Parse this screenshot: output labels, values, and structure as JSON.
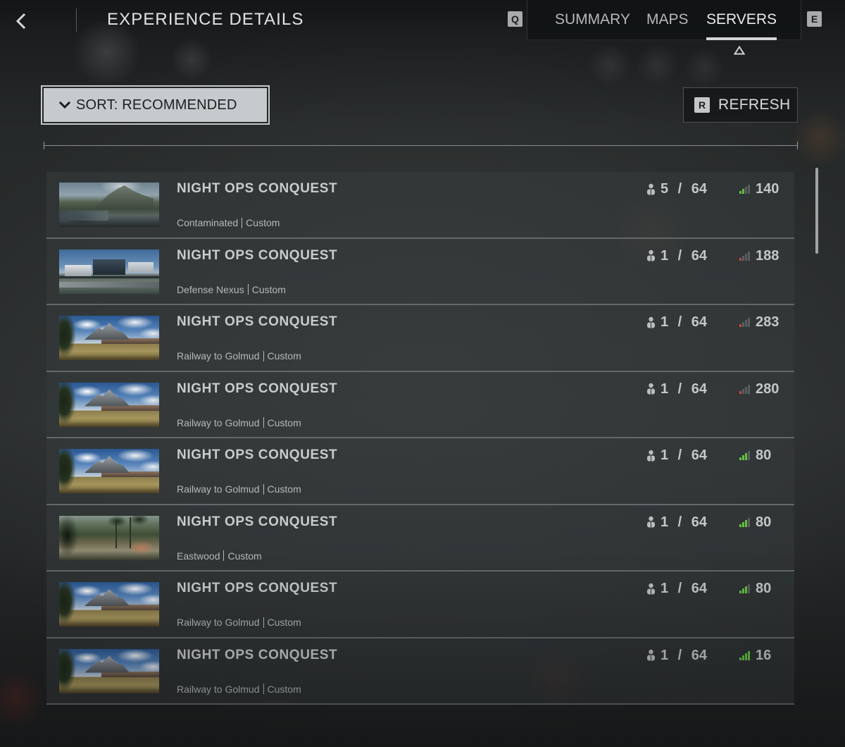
{
  "header": {
    "title": "EXPERIENCE DETAILS",
    "key_prev": "Q",
    "key_next": "E",
    "tabs": [
      {
        "label": "SUMMARY",
        "active": false
      },
      {
        "label": "MAPS",
        "active": false
      },
      {
        "label": "SERVERS",
        "active": true
      }
    ]
  },
  "toolbar": {
    "sort_label": "SORT: RECOMMENDED",
    "refresh_key": "R",
    "refresh_label": "REFRESH"
  },
  "icons": {
    "back": "chevron-left-icon",
    "sort": "chevron-down-icon",
    "tab_indicator": "triangle-up-icon",
    "players": "players-icon",
    "ping": "signal-bars-icon"
  },
  "colors": {
    "signal_good": "#63c03f",
    "signal_poor": "#c9483b",
    "signal_off": "#595d5f",
    "active_tab_underline": "#d3d6d8"
  },
  "servers": [
    {
      "name": "NIGHT OPS CONQUEST",
      "map": "Contaminated",
      "mode": "Custom",
      "players": "5 / 64",
      "ping": "140",
      "signal": {
        "level": 2,
        "color": "#63c03f"
      }
    },
    {
      "name": "NIGHT OPS CONQUEST",
      "map": "Defense Nexus",
      "mode": "Custom",
      "players": "1 / 64",
      "ping": "188",
      "signal": {
        "level": 1,
        "color": "#c9483b"
      }
    },
    {
      "name": "NIGHT OPS CONQUEST",
      "map": "Railway to Golmud",
      "mode": "Custom",
      "players": "1 / 64",
      "ping": "283",
      "signal": {
        "level": 1,
        "color": "#c9483b"
      }
    },
    {
      "name": "NIGHT OPS CONQUEST",
      "map": "Railway to Golmud",
      "mode": "Custom",
      "players": "1 / 64",
      "ping": "280",
      "signal": {
        "level": 1,
        "color": "#c9483b"
      }
    },
    {
      "name": "NIGHT OPS CONQUEST",
      "map": "Railway to Golmud",
      "mode": "Custom",
      "players": "1 / 64",
      "ping": "80",
      "signal": {
        "level": 3,
        "color": "#63c03f"
      }
    },
    {
      "name": "NIGHT OPS CONQUEST",
      "map": "Eastwood",
      "mode": "Custom",
      "players": "1 / 64",
      "ping": "80",
      "signal": {
        "level": 3,
        "color": "#63c03f"
      }
    },
    {
      "name": "NIGHT OPS CONQUEST",
      "map": "Railway to Golmud",
      "mode": "Custom",
      "players": "1 / 64",
      "ping": "80",
      "signal": {
        "level": 3,
        "color": "#63c03f"
      }
    },
    {
      "name": "NIGHT OPS CONQUEST",
      "map": "Railway to Golmud",
      "mode": "Custom",
      "players": "1 / 64",
      "ping": "16",
      "signal": {
        "level": 4,
        "color": "#63c03f"
      }
    }
  ]
}
